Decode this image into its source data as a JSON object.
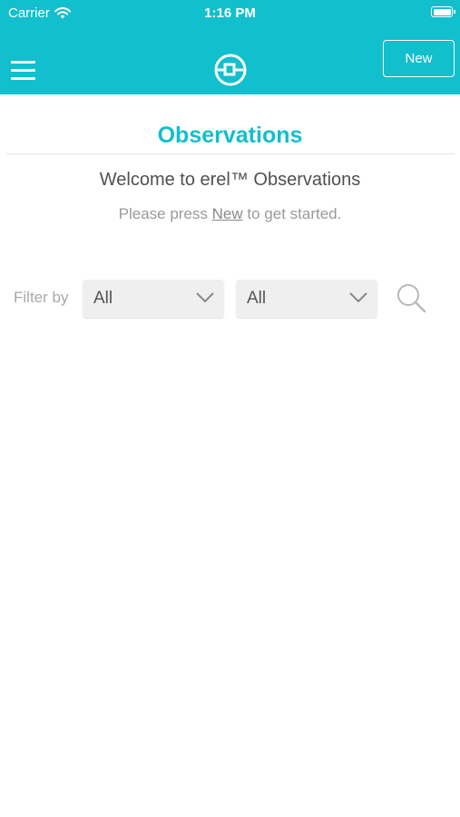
{
  "status_bar": {
    "carrier": "Carrier",
    "time": "1:16 PM",
    "icons": [
      "wifi-icon",
      "battery-icon"
    ]
  },
  "header": {
    "menu_icon": "hamburger-menu-icon",
    "logo_icon": "erel-logo-icon",
    "new_button_label": "New"
  },
  "page": {
    "title": "Observations",
    "welcome": "Welcome to erel™ Observations",
    "hint_prefix": "Please press ",
    "hint_link": "New",
    "hint_suffix": " to get started."
  },
  "filter": {
    "label": "Filter by",
    "select_1_value": "All",
    "select_2_value": "All",
    "search_icon": "search-icon"
  },
  "colors": {
    "accent": "#12bfcc",
    "text_dark": "#505050",
    "text_muted": "#9a9a9a",
    "select_bg": "#efefef"
  }
}
